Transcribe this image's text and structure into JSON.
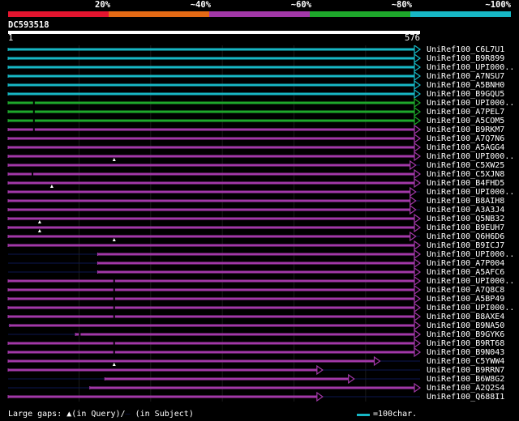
{
  "colors": {
    "background": "#000000",
    "scale": [
      "#e3152f",
      "#e46a15",
      "#a238a8",
      "#1ea82b",
      "#17b7c5"
    ],
    "ruler": "#ffffff",
    "gap_line": "#0c1650",
    "gap_marker": "#ffffff"
  },
  "legend": {
    "labels": [
      "20%",
      "~40%",
      "~60%",
      "~80%",
      "~100%"
    ]
  },
  "query": {
    "id": "DC593518",
    "ruler_start": "1",
    "ruler_end": "576",
    "length": 576
  },
  "hits": [
    {
      "id": "UniRef100_C6L7U1",
      "segments": [
        [
          1,
          576
        ]
      ],
      "color": 4
    },
    {
      "id": "UniRef100_B9R899",
      "segments": [
        [
          1,
          576
        ]
      ],
      "color": 4
    },
    {
      "id": "UniRef100_UPI000..",
      "segments": [
        [
          1,
          576
        ]
      ],
      "color": 4
    },
    {
      "id": "UniRef100_A7NSU7",
      "segments": [
        [
          1,
          576
        ]
      ],
      "color": 4
    },
    {
      "id": "UniRef100_A5BNH0",
      "segments": [
        [
          1,
          576
        ]
      ],
      "color": 4
    },
    {
      "id": "UniRef100_B9GQU5",
      "segments": [
        [
          1,
          576
        ]
      ],
      "color": 4
    },
    {
      "id": "UniRef100_UPI000..",
      "segments": [
        [
          1,
          576
        ]
      ],
      "color": 3,
      "subject_gaps": [
        37
      ]
    },
    {
      "id": "UniRef100_A7PEL7",
      "segments": [
        [
          1,
          576
        ]
      ],
      "color": 3,
      "subject_gaps": [
        37
      ]
    },
    {
      "id": "UniRef100_A5COM5",
      "segments": [
        [
          1,
          576
        ]
      ],
      "color": 3,
      "subject_gaps": [
        37
      ]
    },
    {
      "id": "UniRef100_B9RKM7",
      "segments": [
        [
          1,
          576
        ]
      ],
      "color": 2,
      "subject_gaps": [
        37
      ]
    },
    {
      "id": "UniRef100_A7Q7N6",
      "segments": [
        [
          1,
          576
        ]
      ],
      "color": 2
    },
    {
      "id": "UniRef100_A5AGG4",
      "segments": [
        [
          1,
          576
        ]
      ],
      "color": 2
    },
    {
      "id": "UniRef100_UPI000..",
      "segments": [
        [
          1,
          576
        ]
      ],
      "color": 2,
      "query_gaps": [
        149
      ]
    },
    {
      "id": "UniRef100_C5XW25",
      "segments": [
        [
          1,
          570
        ]
      ],
      "color": 2
    },
    {
      "id": "UniRef100_C5XJN8",
      "segments": [
        [
          1,
          576
        ]
      ],
      "color": 2,
      "subject_gaps": [
        35
      ]
    },
    {
      "id": "UniRef100_B4FHD5",
      "segments": [
        [
          1,
          576
        ]
      ],
      "color": 2,
      "query_gaps": [
        62
      ]
    },
    {
      "id": "UniRef100_UPI000..",
      "segments": [
        [
          1,
          570
        ]
      ],
      "color": 2
    },
    {
      "id": "UniRef100_B8AIH8",
      "segments": [
        [
          1,
          570
        ]
      ],
      "color": 2
    },
    {
      "id": "UniRef100_A3A3J4",
      "segments": [
        [
          1,
          570
        ]
      ],
      "color": 2
    },
    {
      "id": "UniRef100_Q5NB32",
      "segments": [
        [
          1,
          576
        ]
      ],
      "color": 2,
      "query_gaps": [
        45
      ]
    },
    {
      "id": "UniRef100_B9EUH7",
      "segments": [
        [
          1,
          576
        ]
      ],
      "color": 2,
      "query_gaps": [
        45
      ]
    },
    {
      "id": "UniRef100_Q6H6D6",
      "segments": [
        [
          1,
          570
        ]
      ],
      "color": 2,
      "query_gaps": [
        149
      ]
    },
    {
      "id": "UniRef100_B9ICJ7",
      "segments": [
        [
          1,
          576
        ]
      ],
      "color": 2
    },
    {
      "id": "UniRef100_UPI000..",
      "segments": [
        [
          126,
          576
        ]
      ],
      "color": 2
    },
    {
      "id": "UniRef100_A7P004",
      "segments": [
        [
          126,
          576
        ]
      ],
      "color": 2
    },
    {
      "id": "UniRef100_A5AFC6",
      "segments": [
        [
          126,
          576
        ]
      ],
      "color": 2
    },
    {
      "id": "UniRef100_UPI000..",
      "segments": [
        [
          1,
          576
        ]
      ],
      "color": 2,
      "subject_gaps": [
        149
      ]
    },
    {
      "id": "UniRef100_A7Q8C8",
      "segments": [
        [
          1,
          576
        ]
      ],
      "color": 2,
      "subject_gaps": [
        149
      ]
    },
    {
      "id": "UniRef100_A5BP49",
      "segments": [
        [
          1,
          576
        ]
      ],
      "color": 2,
      "subject_gaps": [
        149
      ]
    },
    {
      "id": "UniRef100_UPI000..",
      "segments": [
        [
          1,
          576
        ]
      ],
      "color": 2,
      "subject_gaps": [
        149
      ]
    },
    {
      "id": "UniRef100_B8AXE4",
      "segments": [
        [
          1,
          576
        ]
      ],
      "color": 2,
      "subject_gaps": [
        149
      ]
    },
    {
      "id": "UniRef100_B9NA50",
      "segments": [
        [
          3,
          576
        ]
      ],
      "color": 2
    },
    {
      "id": "UniRef100_B9GYK6",
      "segments": [
        [
          95,
          576
        ]
      ],
      "color": 2,
      "subject_gaps": [
        101
      ]
    },
    {
      "id": "UniRef100_B9RT68",
      "segments": [
        [
          1,
          576
        ]
      ],
      "color": 2,
      "subject_gaps": [
        149
      ]
    },
    {
      "id": "UniRef100_B9N043",
      "segments": [
        [
          1,
          576
        ]
      ],
      "color": 2,
      "subject_gaps": [
        149
      ]
    },
    {
      "id": "UniRef100_C5YWW4",
      "segments": [
        [
          1,
          520
        ]
      ],
      "color": 2,
      "query_gaps": [
        149
      ]
    },
    {
      "id": "UniRef100_B9RRN7",
      "segments": [
        [
          1,
          440
        ]
      ],
      "color": 2
    },
    {
      "id": "UniRef100_B6W8G2",
      "segments": [
        [
          136,
          484
        ]
      ],
      "color": 2
    },
    {
      "id": "UniRef100_A2Q2S4",
      "segments": [
        [
          115,
          576
        ]
      ],
      "color": 2
    },
    {
      "id": "UniRef100_Q688I1",
      "segments": [
        [
          1,
          440
        ]
      ],
      "color": 2
    }
  ],
  "footer": {
    "large_gaps_label": "Large gaps:",
    "query_marker": "▲",
    "in_query_label": "(in Query)/",
    "subject_marker": "—",
    "in_subject_label": "(in Subject)",
    "scale_label": "=100char."
  }
}
